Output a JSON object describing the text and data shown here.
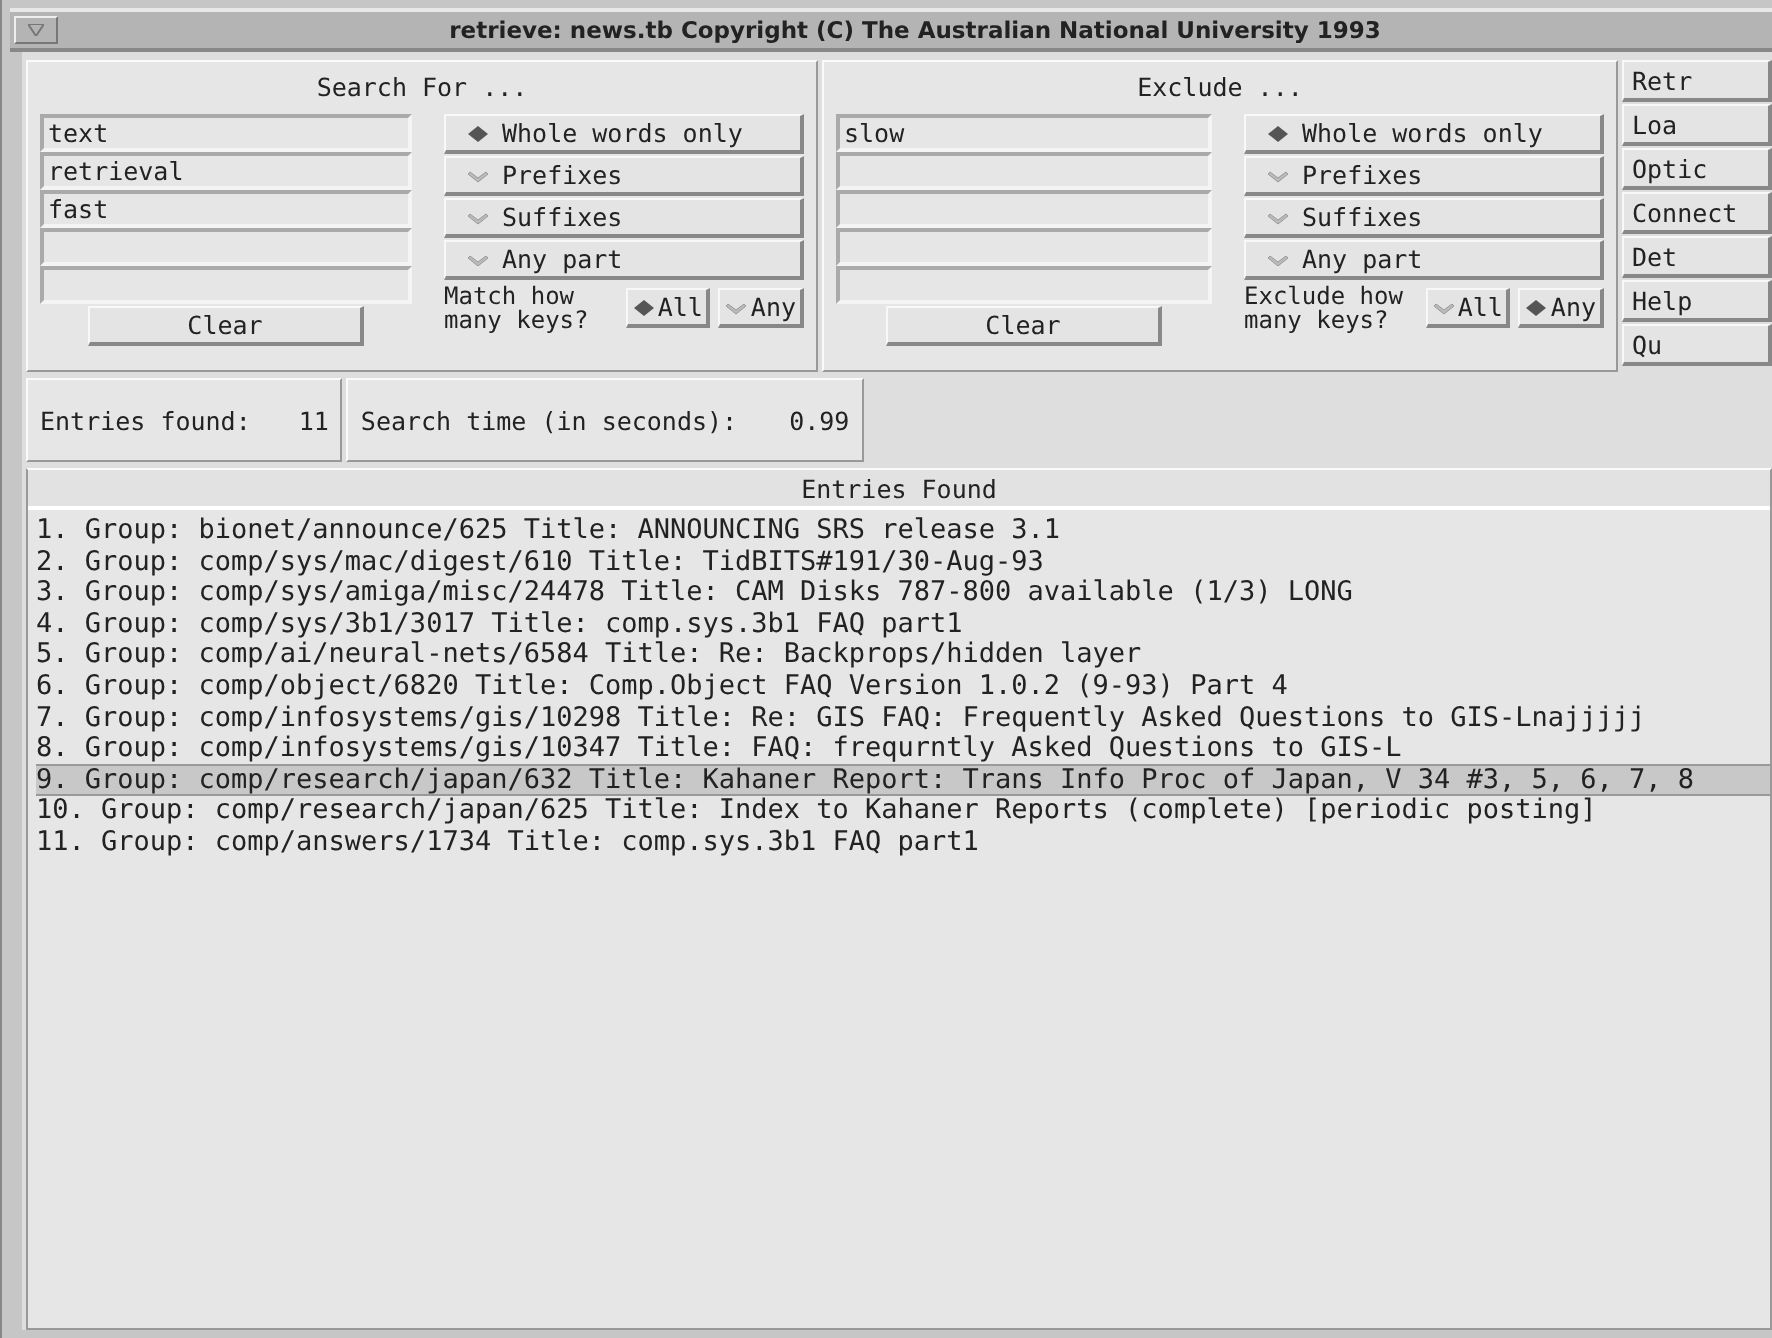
{
  "window": {
    "title": "retrieve: news.tb  Copyright (C) The Australian National University 1993"
  },
  "search": {
    "heading": "Search For ...",
    "keys": [
      "text",
      "retrieval",
      "fast"
    ],
    "modes": [
      {
        "label": "Whole words only",
        "selected": true
      },
      {
        "label": "Prefixes",
        "selected": false
      },
      {
        "label": "Suffixes",
        "selected": false
      },
      {
        "label": "Any part",
        "selected": false
      }
    ],
    "how_label": "Match how many keys?",
    "how_options": [
      {
        "label": "All",
        "selected": true
      },
      {
        "label": "Any",
        "selected": false
      }
    ],
    "clear": "Clear"
  },
  "exclude": {
    "heading": "Exclude ...",
    "keys": [
      "slow"
    ],
    "modes": [
      {
        "label": "Whole words only",
        "selected": true
      },
      {
        "label": "Prefixes",
        "selected": false
      },
      {
        "label": "Suffixes",
        "selected": false
      },
      {
        "label": "Any part",
        "selected": false
      }
    ],
    "how_label": "Exclude how many keys?",
    "how_options": [
      {
        "label": "All",
        "selected": false
      },
      {
        "label": "Any",
        "selected": true
      }
    ],
    "clear": "Clear"
  },
  "side_buttons": [
    "Retr",
    "Loa",
    "Optic",
    "Connect",
    "Det",
    "Help",
    "Qu"
  ],
  "stats": {
    "entries_label": "Entries found:",
    "entries_count": "11",
    "time_label": "Search time (in seconds):",
    "time_value": "0.99"
  },
  "results": {
    "heading": "Entries Found",
    "rows": [
      {
        "text": "1. Group: bionet/announce/625 Title: ANNOUNCING SRS release 3.1",
        "selected": false
      },
      {
        "text": "2. Group: comp/sys/mac/digest/610 Title: TidBITS#191/30-Aug-93",
        "selected": false
      },
      {
        "text": "3. Group: comp/sys/amiga/misc/24478 Title: CAM Disks 787-800 available (1/3) LONG",
        "selected": false
      },
      {
        "text": "4. Group: comp/sys/3b1/3017 Title: comp.sys.3b1 FAQ part1",
        "selected": false
      },
      {
        "text": "5. Group: comp/ai/neural-nets/6584 Title: Re: Backprops/hidden layer",
        "selected": false
      },
      {
        "text": "6. Group: comp/object/6820 Title: Comp.Object FAQ Version 1.0.2 (9-93) Part 4",
        "selected": false
      },
      {
        "text": "7. Group: comp/infosystems/gis/10298 Title: Re: GIS FAQ: Frequently Asked Questions to GIS-Lnajjjjj",
        "selected": false
      },
      {
        "text": "8. Group: comp/infosystems/gis/10347 Title: FAQ: frequrntly Asked Questions to GIS-L",
        "selected": false
      },
      {
        "text": "9. Group: comp/research/japan/632 Title: Kahaner Report: Trans Info Proc of Japan, V 34 #3, 5, 6, 7, 8",
        "selected": true
      },
      {
        "text": "10. Group: comp/research/japan/625 Title: Index to Kahaner Reports (complete) [periodic posting]",
        "selected": false
      },
      {
        "text": "11. Group: comp/answers/1734 Title: comp.sys.3b1 FAQ part1",
        "selected": false
      }
    ]
  }
}
